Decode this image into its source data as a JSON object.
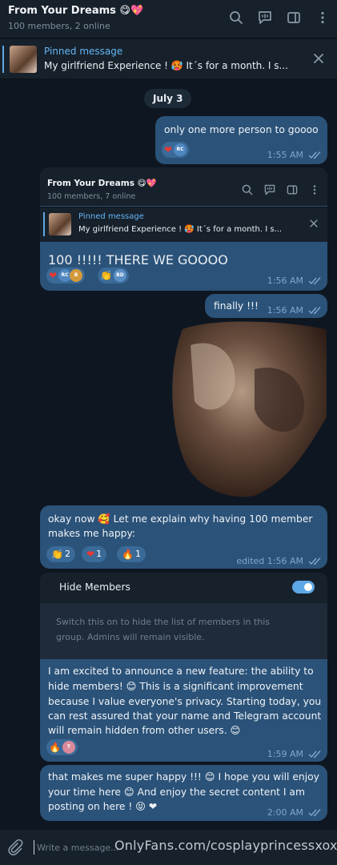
{
  "header": {
    "title": "From Your Dreams 😋💖",
    "subtitle": "100 members, 2 online"
  },
  "pinned": {
    "title": "Pinned message",
    "text": "My girlfriend Experience ! 🥵 It´s for a month. I s..."
  },
  "date": "July 3",
  "messages": [
    {
      "text": "only one more person to goooo",
      "time": "1:55 AM"
    },
    {
      "text": "100 !!!!! THERE WE GOOOO",
      "time": "1:56 AM"
    },
    {
      "text": "finally !!!",
      "time": "1:56 AM"
    },
    {
      "lines": [
        "okay now 🥰 Let me explain why having 100 member",
        "makes me happy:"
      ],
      "time": "edited 1:56 AM",
      "reactions": [
        {
          "emoji": "👏",
          "count": "2"
        },
        {
          "emoji": "❤",
          "count": "1"
        },
        {
          "emoji": "🔥",
          "count": "1"
        }
      ]
    },
    {
      "lines": [
        "I am excited to announce a new feature: the ability to",
        "hide members! 😊 This is a significant improvement",
        "because I value everyone's privacy. Starting today, you",
        "can rest assured that your name and Telegram account",
        "will remain hidden from other users. 😊"
      ],
      "time": "1:59 AM"
    },
    {
      "lines": [
        "that makes me super happy !!! 😊 I hope you will enjoy",
        "your time here 😊 And enjoy the secret content I am",
        "posting on here ! 😝 ❤"
      ],
      "time": "2:00 AM"
    }
  ],
  "screenshot": {
    "title": "From Your Dreams 😋💖",
    "subtitle": "100 members, 7 online",
    "pinned_title": "Pinned message",
    "pinned_text": "My girlfriend Experience ! 🥵 It´s for a month. I s..."
  },
  "avatars": {
    "rc": "RC",
    "b": "B",
    "bd": "BD",
    "t": "T"
  },
  "hide_members": {
    "label": "Hide Members",
    "enabled": true,
    "desc_lines": [
      "Switch this on to hide the list of members in this",
      "group. Admins will remain visible."
    ]
  },
  "composer": {
    "placeholder": "Write a message..."
  },
  "watermark": "OnlyFans.com/cosplayprincessxoxo",
  "icons": {
    "search": "search-icon",
    "voice_chat": "voice-chat-icon",
    "sidebar": "sidebar-toggle-icon",
    "more": "more-vertical-icon",
    "close": "close-icon",
    "attach": "paperclip-icon",
    "read": "double-check-icon"
  },
  "colors": {
    "background": "#0e1621",
    "header": "#17212b",
    "bubble_out": "#2b5278",
    "accent": "#5ea7e6",
    "meta": "#7da8d3"
  }
}
